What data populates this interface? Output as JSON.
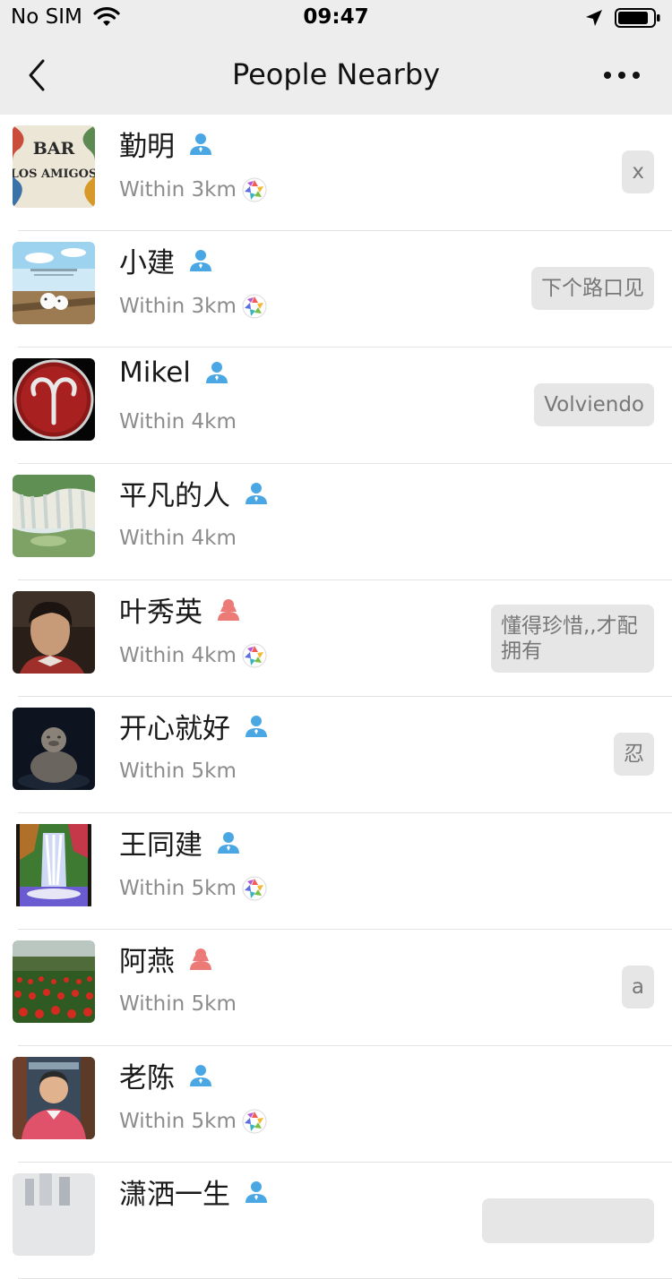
{
  "status_bar": {
    "carrier": "No SIM",
    "time": "09:47"
  },
  "nav": {
    "title": "People Nearby"
  },
  "colors": {
    "male": "#4aa7e4",
    "female": "#ec7a77",
    "bubble": "#e6e6e6"
  },
  "people": [
    {
      "name": "勤明",
      "gender": "male",
      "distance": "Within 3km",
      "moments": true,
      "signature": "x"
    },
    {
      "name": "小建",
      "gender": "male",
      "distance": "Within 3km",
      "moments": true,
      "signature": "下个路口见"
    },
    {
      "name": "Mikel",
      "gender": "male",
      "distance": "Within 4km",
      "moments": false,
      "signature": "Volviendo"
    },
    {
      "name": "平凡的人",
      "gender": "male",
      "distance": "Within 4km",
      "moments": false,
      "signature": ""
    },
    {
      "name": "叶秀英",
      "gender": "female",
      "distance": "Within 4km",
      "moments": true,
      "signature": "懂得珍惜,,才配拥有"
    },
    {
      "name": "开心就好",
      "gender": "male",
      "distance": "Within 5km",
      "moments": false,
      "signature": "忍"
    },
    {
      "name": "王同建",
      "gender": "male",
      "distance": "Within 5km",
      "moments": true,
      "signature": ""
    },
    {
      "name": "阿燕",
      "gender": "female",
      "distance": "Within 5km",
      "moments": false,
      "signature": "a"
    },
    {
      "name": "老陈",
      "gender": "male",
      "distance": "Within 5km",
      "moments": true,
      "signature": ""
    },
    {
      "name": "潇洒一生",
      "gender": "male",
      "distance": "",
      "moments": false,
      "signature": ""
    }
  ]
}
